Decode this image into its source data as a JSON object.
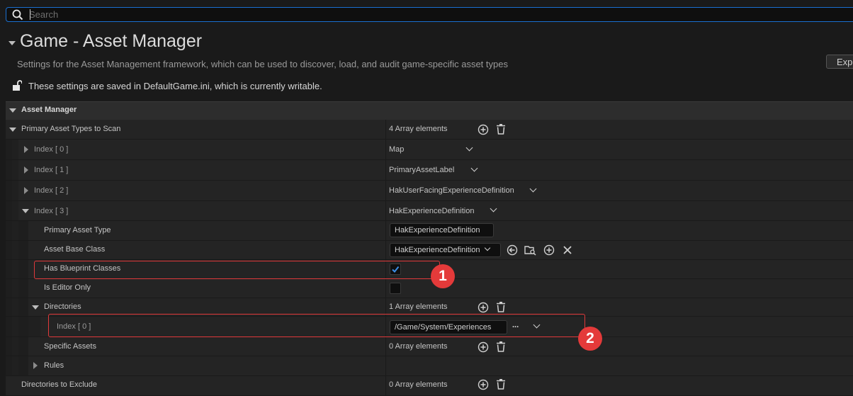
{
  "search": {
    "placeholder": "Search"
  },
  "header": {
    "title": "Game - Asset Manager",
    "subtitle": "Settings for the Asset Management framework, which can be used to discover, load, and audit game-specific asset types",
    "notice": "These settings are saved in DefaultGame.ini, which is currently writable.",
    "export_label": "Export"
  },
  "category": {
    "label": "Asset Manager"
  },
  "properties": {
    "primary_asset_types": {
      "label": "Primary Asset Types to Scan",
      "value": "4 Array elements"
    },
    "index0": {
      "label": "Index [ 0 ]",
      "value": "Map"
    },
    "index1": {
      "label": "Index [ 1 ]",
      "value": "PrimaryAssetLabel"
    },
    "index2": {
      "label": "Index [ 2 ]",
      "value": "HakUserFacingExperienceDefinition"
    },
    "index3": {
      "label": "Index [ 3 ]",
      "value": "HakExperienceDefinition"
    },
    "primary_asset_type": {
      "label": "Primary Asset Type",
      "value": "HakExperienceDefinition"
    },
    "asset_base_class": {
      "label": "Asset Base Class",
      "value": "HakExperienceDefinition"
    },
    "has_blueprint_classes": {
      "label": "Has Blueprint Classes",
      "checked": true
    },
    "is_editor_only": {
      "label": "Is Editor Only",
      "checked": false
    },
    "directories": {
      "label": "Directories",
      "value": "1 Array elements"
    },
    "dir_index0": {
      "label": "Index [ 0 ]",
      "value": "/Game/System/Experiences",
      "more": "..."
    },
    "specific_assets": {
      "label": "Specific Assets",
      "value": "0 Array elements"
    },
    "rules": {
      "label": "Rules"
    },
    "directories_to_exclude": {
      "label": "Directories to Exclude",
      "value": "0 Array elements"
    }
  },
  "annotations": [
    {
      "number": "1"
    },
    {
      "number": "2"
    }
  ],
  "colors": {
    "accent": "#1a6fd0",
    "annotation": "#e43a3a",
    "checkbox_check": "#3b8fe8"
  },
  "icons": [
    "search-icon",
    "unlock-icon",
    "add-icon",
    "trash-icon",
    "back-arrow-icon",
    "browse-icon",
    "close-icon",
    "chevron-down-icon"
  ]
}
